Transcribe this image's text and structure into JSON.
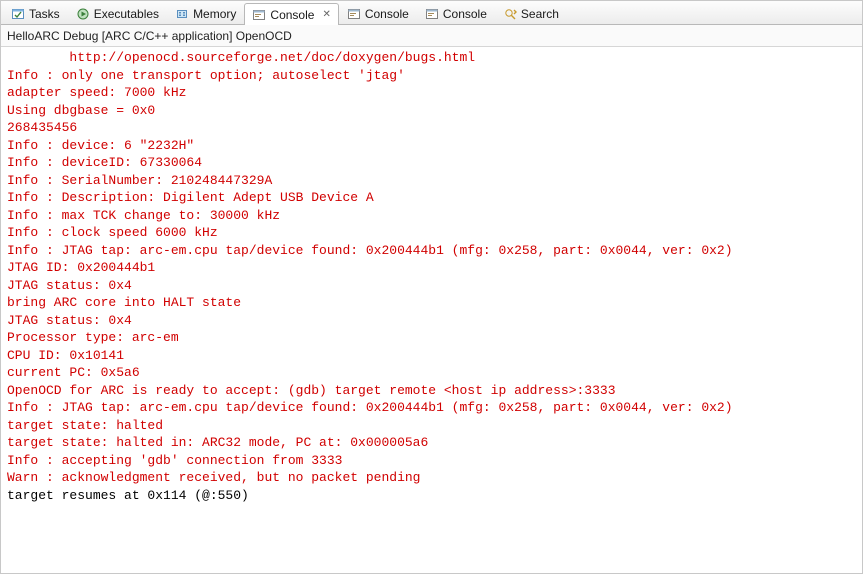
{
  "tabs": [
    {
      "label": "Tasks",
      "icon": "tasks"
    },
    {
      "label": "Executables",
      "icon": "exec"
    },
    {
      "label": "Memory",
      "icon": "memory"
    },
    {
      "label": "Console",
      "icon": "console",
      "active": true,
      "closable": true
    },
    {
      "label": "Console",
      "icon": "console"
    },
    {
      "label": "Console",
      "icon": "console"
    },
    {
      "label": "Search",
      "icon": "search"
    }
  ],
  "subheader": "HelloARC Debug [ARC C/C++ application] OpenOCD",
  "console_lines": [
    {
      "cls": "err",
      "text": "        http://openocd.sourceforge.net/doc/doxygen/bugs.html"
    },
    {
      "cls": "err",
      "text": "Info : only one transport option; autoselect 'jtag'"
    },
    {
      "cls": "err",
      "text": "adapter speed: 7000 kHz"
    },
    {
      "cls": "err",
      "text": "Using dbgbase = 0x0"
    },
    {
      "cls": "err",
      "text": "268435456"
    },
    {
      "cls": "err",
      "text": "Info : device: 6 \"2232H\""
    },
    {
      "cls": "err",
      "text": "Info : deviceID: 67330064"
    },
    {
      "cls": "err",
      "text": "Info : SerialNumber: 210248447329A"
    },
    {
      "cls": "err",
      "text": "Info : Description: Digilent Adept USB Device A"
    },
    {
      "cls": "err",
      "text": "Info : max TCK change to: 30000 kHz"
    },
    {
      "cls": "err",
      "text": "Info : clock speed 6000 kHz"
    },
    {
      "cls": "err",
      "text": "Info : JTAG tap: arc-em.cpu tap/device found: 0x200444b1 (mfg: 0x258, part: 0x0044, ver: 0x2)"
    },
    {
      "cls": "err",
      "text": "JTAG ID: 0x200444b1"
    },
    {
      "cls": "err",
      "text": "JTAG status: 0x4"
    },
    {
      "cls": "err",
      "text": "bring ARC core into HALT state"
    },
    {
      "cls": "err",
      "text": "JTAG status: 0x4"
    },
    {
      "cls": "err",
      "text": "Processor type: arc-em"
    },
    {
      "cls": "err",
      "text": "CPU ID: 0x10141"
    },
    {
      "cls": "err",
      "text": "current PC: 0x5a6"
    },
    {
      "cls": "err",
      "text": "OpenOCD for ARC is ready to accept: (gdb) target remote <host ip address>:3333"
    },
    {
      "cls": "err",
      "text": "Info : JTAG tap: arc-em.cpu tap/device found: 0x200444b1 (mfg: 0x258, part: 0x0044, ver: 0x2)"
    },
    {
      "cls": "err",
      "text": "target state: halted"
    },
    {
      "cls": "err",
      "text": "target state: halted in: ARC32 mode, PC at: 0x000005a6"
    },
    {
      "cls": "err",
      "text": "Info : accepting 'gdb' connection from 3333"
    },
    {
      "cls": "err",
      "text": "Warn : acknowledgment received, but no packet pending"
    },
    {
      "cls": "out",
      "text": "target resumes at 0x114 (@:550)"
    }
  ]
}
